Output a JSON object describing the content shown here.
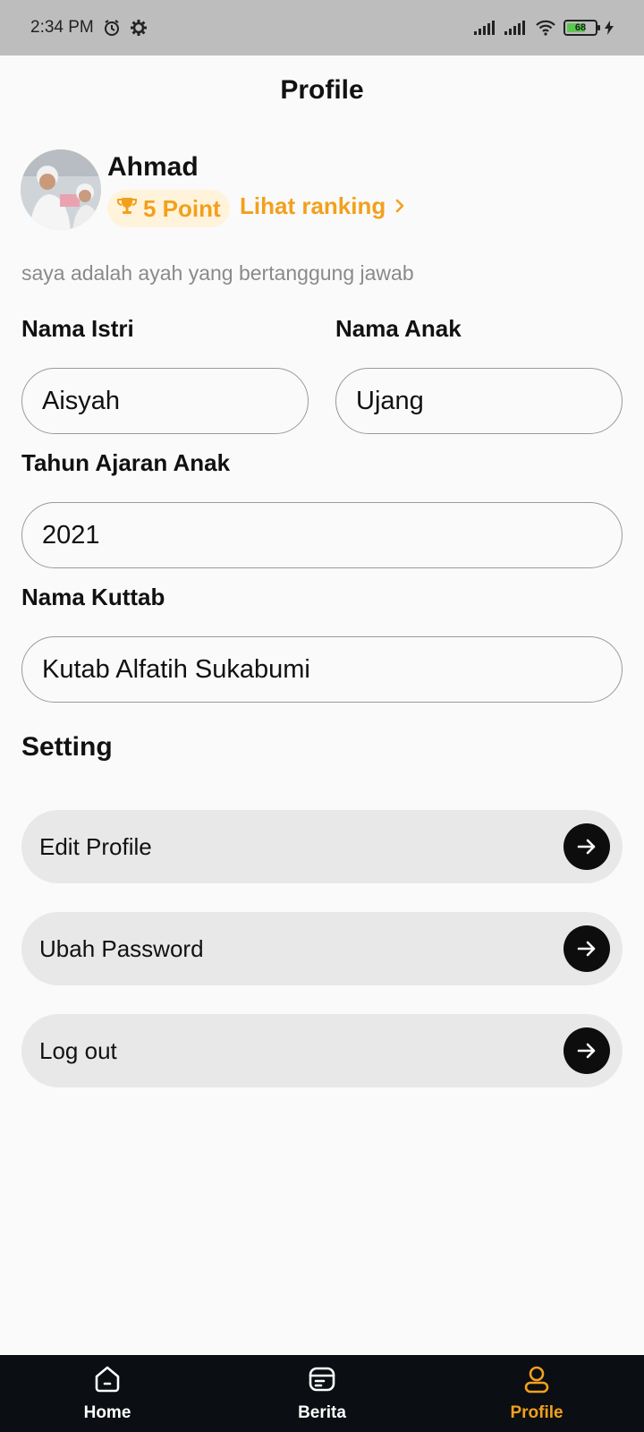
{
  "status_bar": {
    "time": "2:34 PM",
    "battery_level": "68",
    "icons": [
      "alarm-icon",
      "settings-gear-icon",
      "signal-icon",
      "signal-icon",
      "wifi-icon",
      "battery-icon",
      "charging-icon"
    ]
  },
  "header": {
    "title": "Profile"
  },
  "user": {
    "name": "Ahmad",
    "points_label": "5 Point",
    "ranking_link": "Lihat ranking",
    "bio": "saya adalah ayah yang bertanggung jawab"
  },
  "fields": {
    "wife_name": {
      "label": "Nama Istri",
      "value": "Aisyah"
    },
    "child_name": {
      "label": "Nama Anak",
      "value": "Ujang"
    },
    "school_year": {
      "label": "Tahun Ajaran Anak",
      "value": "2021"
    },
    "kuttab_name": {
      "label": "Nama Kuttab",
      "value": "Kutab Alfatih Sukabumi"
    }
  },
  "settings": {
    "title": "Setting",
    "items": [
      {
        "label": "Edit Profile"
      },
      {
        "label": "Ubah Password"
      },
      {
        "label": "Log out"
      }
    ]
  },
  "bottom_nav": {
    "items": [
      {
        "label": "Home",
        "icon": "home-icon"
      },
      {
        "label": "Berita",
        "icon": "news-icon"
      },
      {
        "label": "Profile",
        "icon": "user-icon",
        "active": true
      }
    ]
  },
  "colors": {
    "accent": "#f2a01c",
    "background": "#fafafa",
    "nav_background": "#0b0e12",
    "status_bar": "#bdbdbd",
    "setting_item_bg": "#e8e8e8"
  }
}
